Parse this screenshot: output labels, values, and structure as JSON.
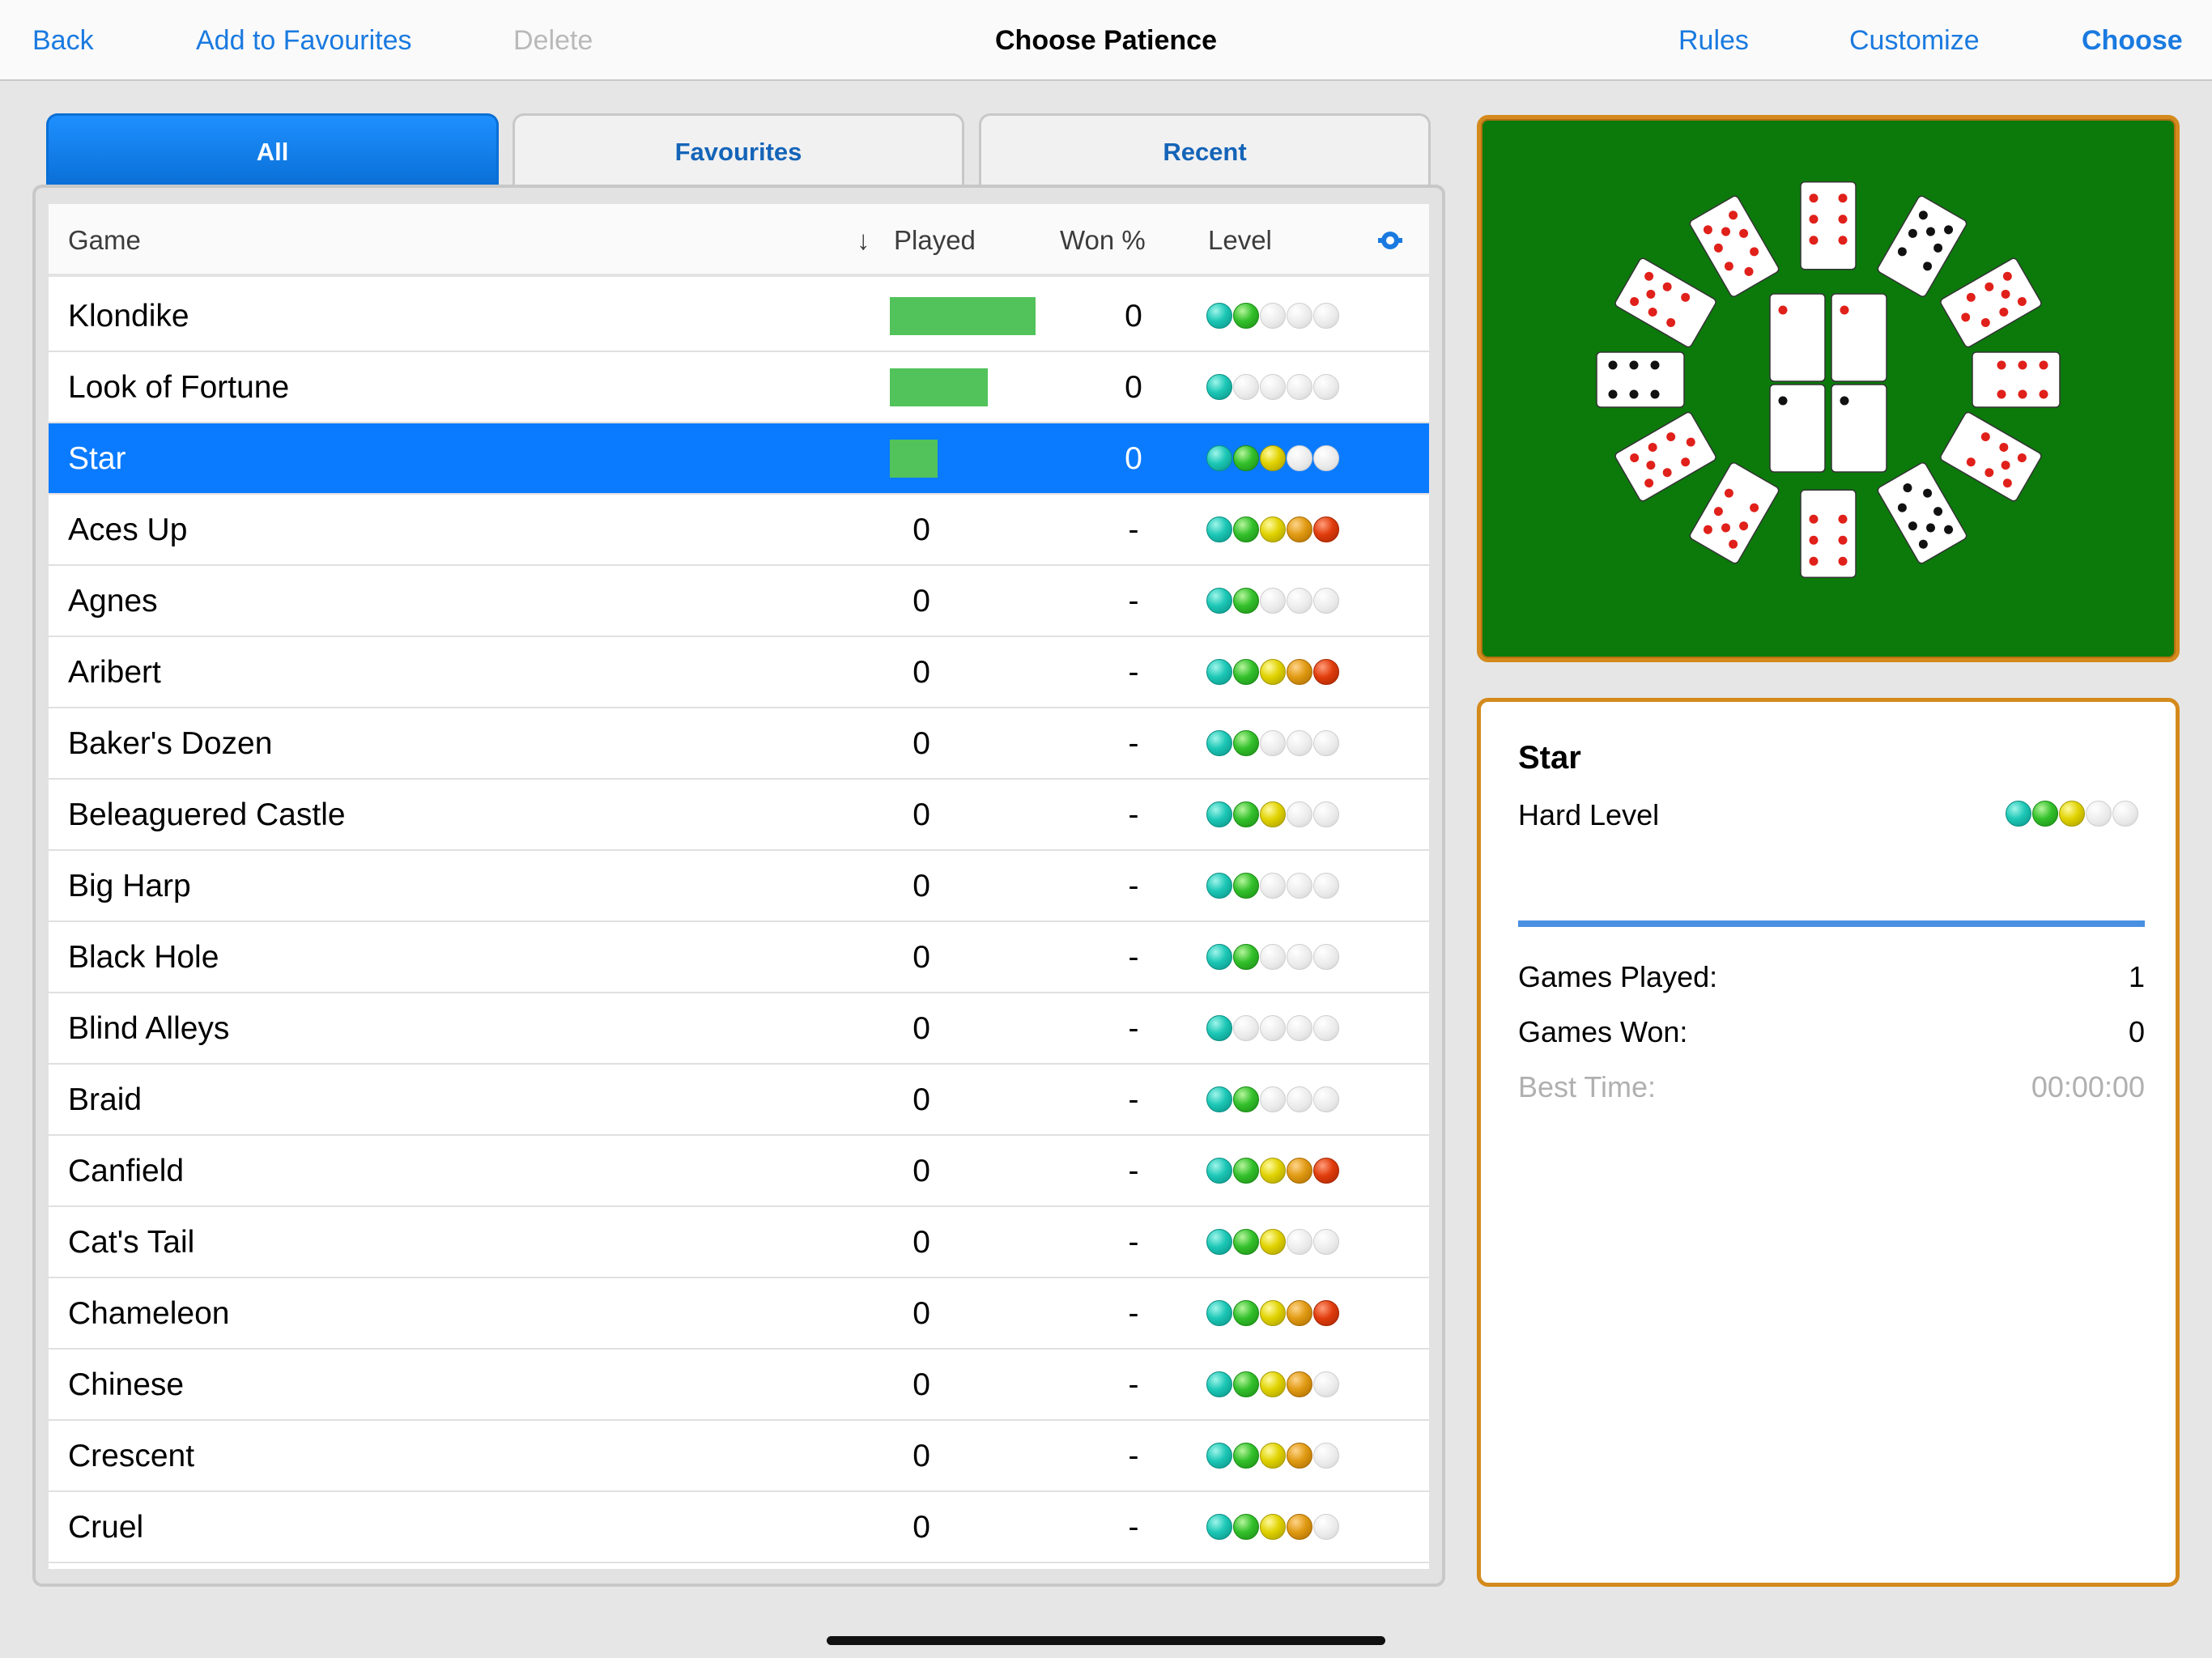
{
  "nav": {
    "back": "Back",
    "add_fav": "Add to Favourites",
    "delete": "Delete",
    "title": "Choose Patience",
    "rules": "Rules",
    "customize": "Customize",
    "choose": "Choose"
  },
  "tabs": [
    "All",
    "Favourites",
    "Recent"
  ],
  "list": {
    "columns": {
      "game": "Game",
      "sort_arrow": "↓",
      "played": "Played",
      "won": "Won %",
      "level": "Level"
    },
    "rows": [
      {
        "name": "Klondike",
        "played": "3",
        "played_fraction": 1.0,
        "won": "0",
        "level": [
          "teal",
          "green",
          "empty",
          "empty",
          "empty"
        ]
      },
      {
        "name": "Look of Fortune",
        "played": "2",
        "played_fraction": 0.67,
        "won": "0",
        "level": [
          "teal",
          "empty",
          "empty",
          "empty",
          "empty"
        ]
      },
      {
        "name": "Star",
        "played": "1",
        "played_fraction": 0.33,
        "won": "0",
        "level": [
          "teal",
          "green",
          "yellow",
          "empty",
          "empty"
        ],
        "selected": true
      },
      {
        "name": "Aces Up",
        "played": "0",
        "won": "-",
        "level": [
          "teal",
          "green",
          "yellow",
          "orange",
          "red"
        ]
      },
      {
        "name": "Agnes",
        "played": "0",
        "won": "-",
        "level": [
          "teal",
          "green",
          "empty",
          "empty",
          "empty"
        ]
      },
      {
        "name": "Aribert",
        "played": "0",
        "won": "-",
        "level": [
          "teal",
          "green",
          "yellow",
          "orange",
          "red"
        ]
      },
      {
        "name": "Baker's Dozen",
        "played": "0",
        "won": "-",
        "level": [
          "teal",
          "green",
          "empty",
          "empty",
          "empty"
        ]
      },
      {
        "name": "Beleaguered Castle",
        "played": "0",
        "won": "-",
        "level": [
          "teal",
          "green",
          "yellow",
          "empty",
          "empty"
        ]
      },
      {
        "name": "Big Harp",
        "played": "0",
        "won": "-",
        "level": [
          "teal",
          "green",
          "empty",
          "empty",
          "empty"
        ]
      },
      {
        "name": "Black Hole",
        "played": "0",
        "won": "-",
        "level": [
          "teal",
          "green",
          "empty",
          "empty",
          "empty"
        ]
      },
      {
        "name": "Blind Alleys",
        "played": "0",
        "won": "-",
        "level": [
          "teal",
          "empty",
          "empty",
          "empty",
          "empty"
        ]
      },
      {
        "name": "Braid",
        "played": "0",
        "won": "-",
        "level": [
          "teal",
          "green",
          "empty",
          "empty",
          "empty"
        ]
      },
      {
        "name": "Canfield",
        "played": "0",
        "won": "-",
        "level": [
          "teal",
          "green",
          "yellow",
          "orange",
          "red"
        ]
      },
      {
        "name": "Cat's Tail",
        "played": "0",
        "won": "-",
        "level": [
          "teal",
          "green",
          "yellow",
          "empty",
          "empty"
        ]
      },
      {
        "name": "Chameleon",
        "played": "0",
        "won": "-",
        "level": [
          "teal",
          "green",
          "yellow",
          "orange",
          "red"
        ]
      },
      {
        "name": "Chinese",
        "played": "0",
        "won": "-",
        "level": [
          "teal",
          "green",
          "yellow",
          "orange",
          "empty"
        ]
      },
      {
        "name": "Crescent",
        "played": "0",
        "won": "-",
        "level": [
          "teal",
          "green",
          "yellow",
          "orange",
          "empty"
        ]
      },
      {
        "name": "Cruel",
        "played": "0",
        "won": "-",
        "level": [
          "teal",
          "green",
          "yellow",
          "orange",
          "empty"
        ]
      }
    ]
  },
  "info": {
    "title": "Star",
    "level_text": "Hard Level",
    "level": [
      "teal",
      "green",
      "yellow",
      "empty",
      "empty"
    ],
    "games_played_label": "Games Played:",
    "games_played": "1",
    "games_won_label": "Games Won:",
    "games_won": "0",
    "best_time_label": "Best Time:",
    "best_time": "00:00:00"
  },
  "colors": {
    "accent": "#1a7ae0",
    "selected_row": "#0a7bff",
    "bar": "#52c25b",
    "felt": "#0b7a0b",
    "frame": "#d48a1c"
  }
}
